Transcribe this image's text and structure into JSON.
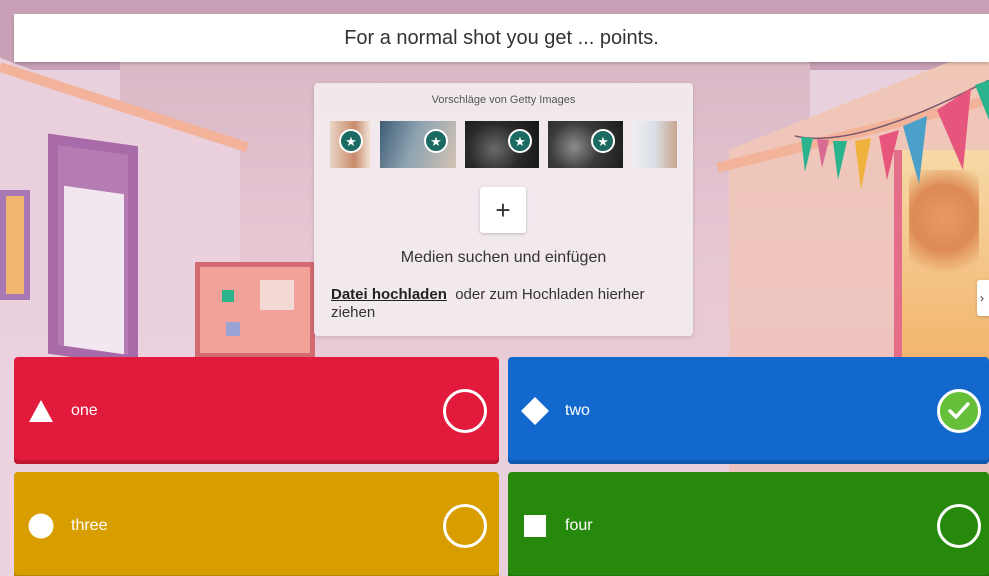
{
  "question": {
    "text": "For a normal shot you get ... points."
  },
  "media_panel": {
    "getty_title": "Vorschläge von Getty Images",
    "thumbnails": [
      {
        "icon": "star-badge-icon",
        "colors": [
          "#c98b6a",
          "#e9d5c5"
        ]
      },
      {
        "icon": "star-badge-icon",
        "colors": [
          "#4d6e86",
          "#d3c2b3"
        ]
      },
      {
        "icon": "star-badge-icon",
        "colors": [
          "#141414",
          "#6a6a6a"
        ]
      },
      {
        "icon": "star-badge-icon",
        "colors": [
          "#1a1a1a",
          "#8c8c8c"
        ]
      },
      {
        "icon": "none",
        "colors": [
          "#dcdfe6",
          "#c7a58f"
        ]
      }
    ],
    "add_icon": "+",
    "search_label": "Medien suchen und einfügen",
    "upload_link": "Datei hochladen",
    "upload_rest": "oder zum Hochladen hierher ziehen"
  },
  "side_arrow": {
    "icon": "chevron-right-icon",
    "glyph": "›"
  },
  "answers": [
    {
      "label": "one",
      "shape": "triangle",
      "color": "#e21b3c",
      "checked": false
    },
    {
      "label": "two",
      "shape": "diamond",
      "color": "#1368ce",
      "checked": true
    },
    {
      "label": "three",
      "shape": "circle",
      "color": "#d89e00",
      "checked": false
    },
    {
      "label": "four",
      "shape": "square",
      "color": "#26890c",
      "checked": false
    }
  ],
  "colors": {
    "check_green": "#66bf39",
    "getty_badge": "#1b6b63"
  }
}
